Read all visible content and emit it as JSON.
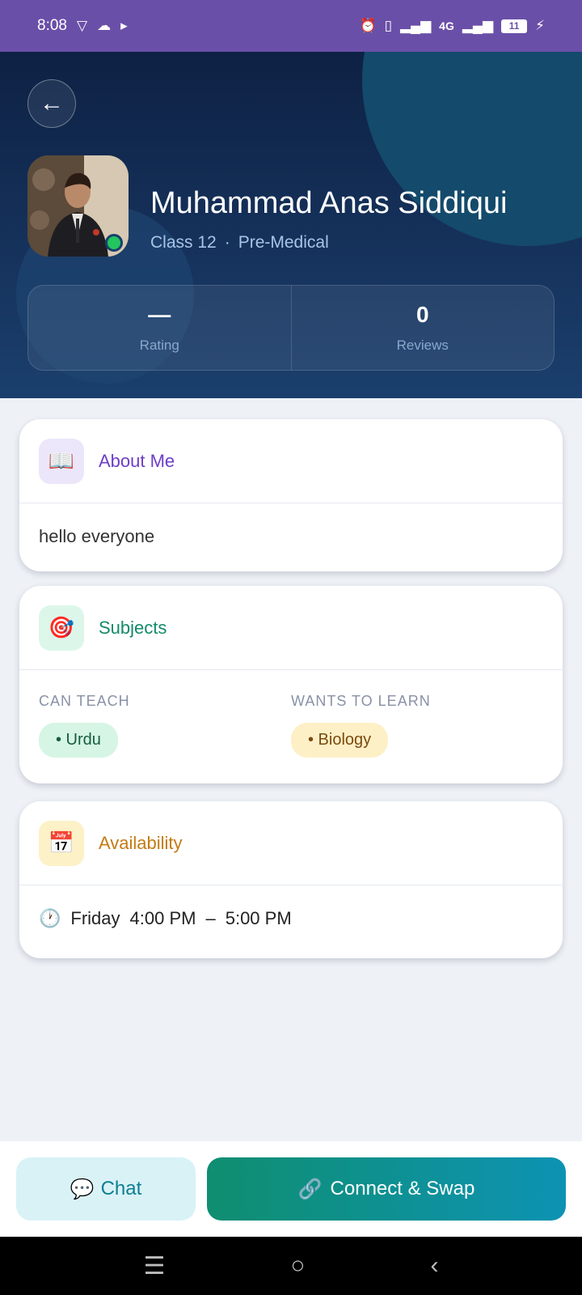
{
  "status_bar": {
    "time": "8:08",
    "network": "4G",
    "battery": "11"
  },
  "header": {
    "back_icon": "arrow-left-icon",
    "name": "Muhammad Anas Siddiqui",
    "class": "Class 12",
    "separator": "·",
    "stream": "Pre-Medical",
    "online_color": "#22c55e",
    "stats": [
      {
        "value": "—",
        "label": "Rating"
      },
      {
        "value": "0",
        "label": "Reviews"
      }
    ]
  },
  "about": {
    "icon": "book-icon",
    "title": "About Me",
    "text": "hello everyone",
    "accent": "#6d3fc7"
  },
  "subjects": {
    "icon": "target-icon",
    "title": "Subjects",
    "accent": "#138a68",
    "can_teach_label": "CAN TEACH",
    "can_teach": [
      "• Urdu"
    ],
    "wants_to_learn_label": "WANTS TO LEARN",
    "wants_to_learn": [
      "• Biology"
    ]
  },
  "availability": {
    "icon": "calendar-icon",
    "title": "Availability",
    "accent": "#c47b12",
    "day": "Friday",
    "start": "4:00 PM",
    "dash": "–",
    "end": "5:00 PM"
  },
  "actions": {
    "chat_label": "Chat",
    "connect_label": "Connect & Swap"
  }
}
